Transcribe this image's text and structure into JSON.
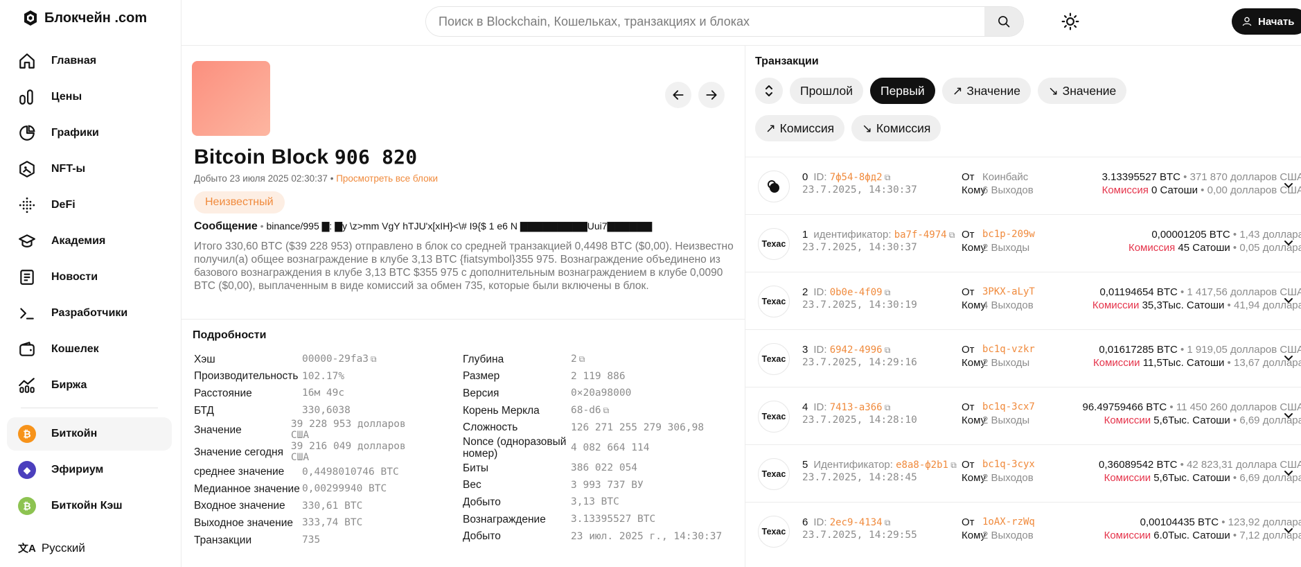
{
  "brand": {
    "name": "Блокчейн .com"
  },
  "nav": [
    {
      "label": "Главная",
      "icon": "home-icon"
    },
    {
      "label": "Цены",
      "icon": "prices-icon"
    },
    {
      "label": "Графики",
      "icon": "charts-icon"
    },
    {
      "label": "NFT-ы",
      "icon": "nft-icon"
    },
    {
      "label": "DeFi",
      "icon": "defi-icon"
    },
    {
      "label": "Академия",
      "icon": "academy-icon"
    },
    {
      "label": "Новости",
      "icon": "news-icon"
    },
    {
      "label": "Разработчики",
      "icon": "terminal-icon"
    },
    {
      "label": "Кошелек",
      "icon": "wallet-icon"
    },
    {
      "label": "Биржа",
      "icon": "exchange-icon"
    }
  ],
  "coins": [
    {
      "label": "Биткойн",
      "color": "#f7931a",
      "glyph": "₿",
      "active": true
    },
    {
      "label": "Эфириум",
      "color": "#4b3fbd",
      "glyph": "◆",
      "active": false
    },
    {
      "label": "Биткойн Кэш",
      "color": "#8dc351",
      "glyph": "₿",
      "active": false
    }
  ],
  "language": "Русский",
  "search": {
    "placeholder": "Поиск в Blockchain, Кошельках, транзакциях и блоках"
  },
  "header": {
    "start_label": "Начать"
  },
  "block": {
    "title_prefix": "Bitcoin Block",
    "number": "906 820",
    "mined_text": "Добыто 23 июля 2025 02:30:37",
    "bullet": "•",
    "view_all_link": "Просмотреть все блоки",
    "badge": "Неизвестный",
    "message_label": "Сообщение",
    "message_text": "binance/995 ▇: ▇y \\z>mm VgY hTJU'x[xIH}<\\# I9{$ 1 e6 N ▇▇▇▇▇▇▇▇▇Uui7▇▇▇▇▇▇",
    "summary": "Итого 330,60 BTC ($39 228 953) отправлено в блок со средней транзакцией 0,4498 BTC ($0,00). Неизвестно получил(а) общее вознаграждение в клубе 3,13 BTC {fiatsymbol}355 975. Вознаграждение объединено из базового вознаграждения в клубе 3,13 BTC $355 975 с дополнительным вознаграждением в клубе 0,0090 BTC ($0,00), выплаченным в виде комиссий за обмен 735, которые были включены в блок."
  },
  "details": {
    "title": "Подробности",
    "left": [
      {
        "label": "Хэш",
        "value": "00000-29fa3"
      },
      {
        "label": "Производительность",
        "value": "102.17%"
      },
      {
        "label": "Расстояние",
        "value": "16м 49с"
      },
      {
        "label": "БТД",
        "value": "330,6038"
      },
      {
        "label": "Значение",
        "value": "39 228 953 долларов США"
      },
      {
        "label": "Значение сегодня",
        "value": "39 216 049 долларов США"
      },
      {
        "label": "среднее значение",
        "value": "0,4498010746 BTC"
      },
      {
        "label": "Медианное значение",
        "value": "0,00299940 BTC"
      },
      {
        "label": "Входное значение",
        "value": "330,61 BTC"
      },
      {
        "label": "Выходное значение",
        "value": "333,74 BTC"
      },
      {
        "label": "Транзакции",
        "value": "735"
      }
    ],
    "right": [
      {
        "label": "Глубина",
        "value": "2"
      },
      {
        "label": "Размер",
        "value": "2 119 886"
      },
      {
        "label": "Версия",
        "value": "0×20a98000"
      },
      {
        "label": "Корень Меркла",
        "value": "68-d6"
      },
      {
        "label": "Сложность",
        "value": "126 271 255 279 306,98"
      },
      {
        "label": "Nonce (одноразовый номер)",
        "value": "4 082 664 114"
      },
      {
        "label": "Биты",
        "value": "386 022 054"
      },
      {
        "label": "Вес",
        "value": "3 993 737 ВУ"
      },
      {
        "label": "Добыто",
        "value": "3,13 BTC"
      },
      {
        "label": "Вознаграждение",
        "value": "3.13395527 BTC"
      },
      {
        "label": "Добыто",
        "value": "23 июл. 2025 г., 14:30:37"
      }
    ]
  },
  "transactions": {
    "title": "Транзакции",
    "filters": [
      {
        "label": "",
        "icon": "sort-icon",
        "active": false
      },
      {
        "label": "Прошлой",
        "icon": "",
        "active": false
      },
      {
        "label": "Первый",
        "icon": "",
        "active": true
      },
      {
        "label": "Значение",
        "icon": "arrow-up-right-icon",
        "active": false
      },
      {
        "label": "Значение",
        "icon": "arrow-down-right-icon",
        "active": false
      },
      {
        "label": "Комиссия",
        "icon": "arrow-up-right-icon",
        "active": false
      },
      {
        "label": "Комиссия",
        "icon": "arrow-down-right-icon",
        "active": false
      }
    ],
    "rows": [
      {
        "index": "0",
        "id_label": "ID:",
        "id": "7ф54-8фд2",
        "time": "23.7.2025, 14:30:37",
        "avatar": "coinbase",
        "from_label": "От",
        "from": "Коинбайс",
        "from_grey": true,
        "amount": "3.13395527 BTC",
        "amount_usd": "371 870 долларов США",
        "to_label": "Кому",
        "outputs": "6 Выходов",
        "fee_label": "Комиссия",
        "fee": "0 Сатоши",
        "fee_usd": "0,00 долларов США"
      },
      {
        "index": "1",
        "id_label": "идентификатор:",
        "id": "ba7f-4974",
        "time": "23.7.2025, 14:30:37",
        "avatar": "Техас",
        "from_label": "От",
        "from": "bc1p-209w",
        "from_grey": false,
        "amount": "0,00001205 BTC",
        "amount_usd": "1,43 доллара",
        "to_label": "Кому",
        "outputs": "2 Выходы",
        "fee_label": "Комиссия",
        "fee": "45 Сатоши",
        "fee_usd": "0,05 доллара"
      },
      {
        "index": "2",
        "id_label": "ID:",
        "id": "0b0e-4f09",
        "time": "23.7.2025, 14:30:19",
        "avatar": "Техас",
        "from_label": "От",
        "from": "3PKX-aLyT",
        "from_grey": false,
        "amount": "0,01194654 BTC",
        "amount_usd": "1 417,56 долларов США",
        "to_label": "Кому",
        "outputs": "4 Выходов",
        "fee_label": "Комиссии",
        "fee": "35,3Тыс. Сатоши",
        "fee_usd": "41,94 доллара"
      },
      {
        "index": "3",
        "id_label": "ID:",
        "id": "6942-4996",
        "time": "23.7.2025, 14:29:16",
        "avatar": "Техас",
        "from_label": "От",
        "from": "bc1q-vzkr",
        "from_grey": false,
        "amount": "0,01617285 BTC",
        "amount_usd": "1 919,05 долларов США",
        "to_label": "Кому",
        "outputs": "2 Выходы",
        "fee_label": "Комиссии",
        "fee": "11,5Тыс. Сатоши",
        "fee_usd": "13,67 доллара"
      },
      {
        "index": "4",
        "id_label": "ID:",
        "id": "7413-a366",
        "time": "23.7.2025, 14:28:10",
        "avatar": "Техас",
        "from_label": "От",
        "from": "bc1q-3cx7",
        "from_grey": false,
        "amount": "96.49759466 BTC",
        "amount_usd": "11 450 260 долларов США",
        "to_label": "Кому",
        "outputs": "2 Выходы",
        "fee_label": "Комиссии",
        "fee": "5,6Тыс. Сатоши",
        "fee_usd": "6,69 доллара"
      },
      {
        "index": "5",
        "id_label": "Идентификатор:",
        "id": "e8a8-ф2b1",
        "time": "23.7.2025, 14:28:45",
        "avatar": "Техас",
        "from_label": "От",
        "from": "bc1q-3cyx",
        "from_grey": false,
        "amount": "0,36089542 BTC",
        "amount_usd": "42 823,31 доллара США",
        "to_label": "Кому",
        "outputs": "2 Выходов",
        "fee_label": "Комиссии",
        "fee": "5,6Тыс. Сатоши",
        "fee_usd": "6,69 доллара"
      },
      {
        "index": "6",
        "id_label": "ID:",
        "id": "2ec9-4134",
        "time": "23.7.2025, 14:29:55",
        "avatar": "Техас",
        "from_label": "От",
        "from": "1oAX-rzWq",
        "from_grey": false,
        "amount": "0,00104435 BTC",
        "amount_usd": "123,92 доллара",
        "to_label": "Кому",
        "outputs": "2 Выходов",
        "fee_label": "Комиссии",
        "fee": "6.0Тыс. Сатоши",
        "fee_usd": "7,12 доллара"
      }
    ]
  },
  "colors": {
    "accent": "#f08a3c",
    "fee_red": "#e5344b",
    "dark": "#111111"
  }
}
